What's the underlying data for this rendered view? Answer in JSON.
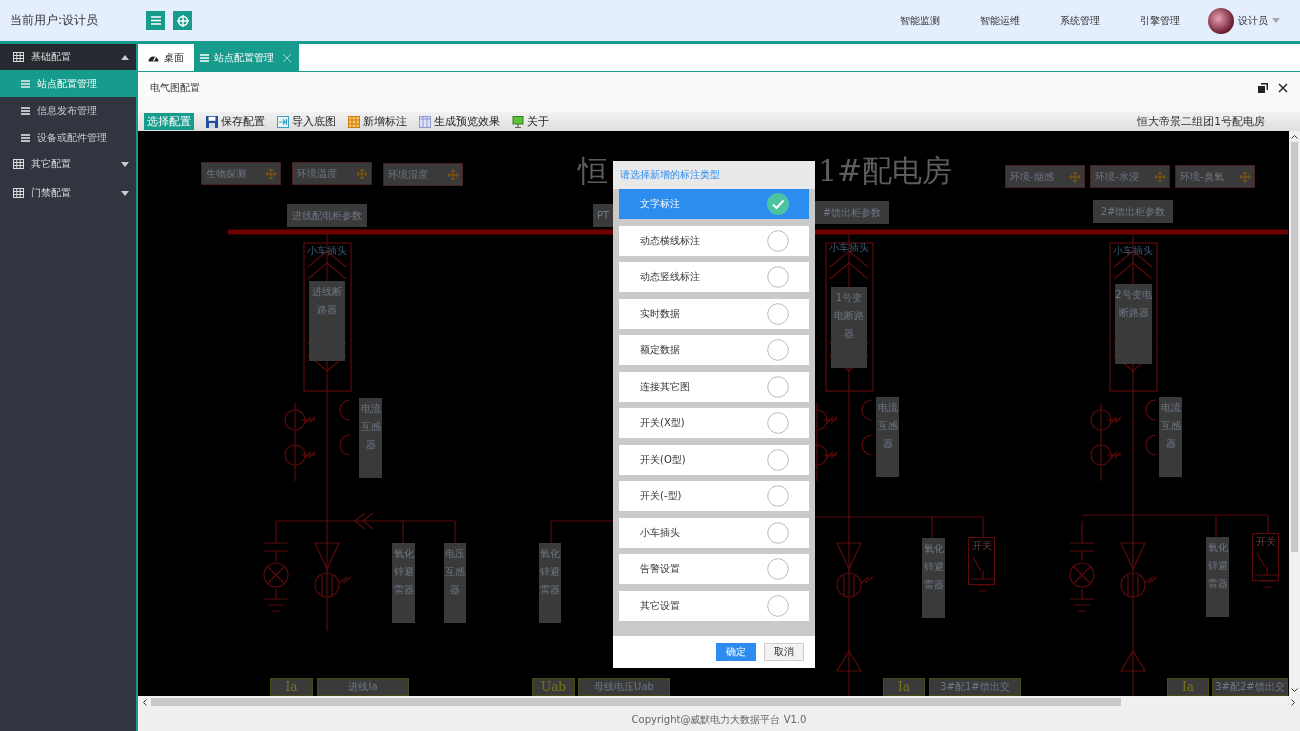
{
  "header": {
    "current_user": "当前用户:设计员",
    "nav": [
      "智能监测",
      "智能运维",
      "系统管理",
      "引擎管理"
    ],
    "user_name": "设计员"
  },
  "sidebar": {
    "groups": [
      {
        "label": "基础配置",
        "expanded": true,
        "children": [
          {
            "label": "站点配置管理",
            "selected": true
          },
          {
            "label": "信息发布管理",
            "selected": false
          },
          {
            "label": "设备或配件管理",
            "selected": false
          }
        ]
      },
      {
        "label": "其它配置",
        "expanded": false
      },
      {
        "label": "门禁配置",
        "expanded": false
      }
    ]
  },
  "tabs": [
    {
      "label": "桌面",
      "selected": false,
      "kind": "home"
    },
    {
      "label": "站点配置管理",
      "selected": true,
      "kind": "page"
    }
  ],
  "panel": {
    "title": "电气图配置"
  },
  "toolbar": {
    "buttons": [
      {
        "label": "选择配置",
        "kind": "primary"
      },
      {
        "label": "保存配置",
        "kind": "save"
      },
      {
        "label": "导入底图",
        "kind": "import"
      },
      {
        "label": "新增标注",
        "kind": "annotate"
      },
      {
        "label": "生成预览效果",
        "kind": "preview"
      },
      {
        "label": "关于",
        "kind": "about"
      }
    ],
    "site_name": "恒大帝景二组团1号配电房"
  },
  "diagram": {
    "title_parts": [
      "恒",
      "1#配电房"
    ],
    "sensors": [
      "生物探测",
      "环境温度",
      "环境湿度",
      "环境-烟感",
      "环境-水浸",
      "环境-臭氧"
    ],
    "parameter_boxes": [
      "进线配电柜参数",
      "PT",
      "#馈出柜参数",
      "2#馈出柜参数"
    ],
    "devices": [
      {
        "kind": "cart",
        "label": "小车插头"
      },
      {
        "kind": "cart",
        "label": "小车插头"
      },
      {
        "kind": "cart",
        "label": "小车插头"
      },
      {
        "kind": "device",
        "label": "进线断路器"
      },
      {
        "kind": "device",
        "label": "1号变电断路器"
      },
      {
        "kind": "device",
        "label": "2号变电断路器"
      },
      {
        "kind": "device",
        "label": "电流互感器"
      },
      {
        "kind": "device",
        "label": "电流互感器"
      },
      {
        "kind": "device",
        "label": "电流互感器"
      },
      {
        "kind": "device",
        "label": "氧化锌避雷器"
      },
      {
        "kind": "device",
        "label": "电压互感器"
      },
      {
        "kind": "device",
        "label": "氧化锌避雷器"
      },
      {
        "kind": "device",
        "label": "氧化锌避雷器"
      },
      {
        "kind": "switch",
        "label": "开关"
      },
      {
        "kind": "device",
        "label": "氧化锌避雷器"
      },
      {
        "kind": "switch",
        "label": "开关"
      }
    ],
    "readings": [
      {
        "kind": "symbol",
        "label": "Ia"
      },
      {
        "kind": "name",
        "label": "进线Ia"
      },
      {
        "kind": "symbol",
        "label": "Uab"
      },
      {
        "kind": "name",
        "label": "母线电压Uab"
      },
      {
        "kind": "symbol",
        "label": "Ia"
      },
      {
        "kind": "name",
        "label": "3#配1#馈出交"
      },
      {
        "kind": "symbol",
        "label": "Ia"
      },
      {
        "kind": "name",
        "label": "3#配2#馈出交"
      }
    ]
  },
  "dialog": {
    "title": "请选择新增的标注类型",
    "options": [
      {
        "label": "文字标注",
        "selected": true
      },
      {
        "label": "动态横线标注",
        "selected": false
      },
      {
        "label": "动态竖线标注",
        "selected": false
      },
      {
        "label": "实时数据",
        "selected": false
      },
      {
        "label": "额定数据",
        "selected": false
      },
      {
        "label": "连接其它图",
        "selected": false
      },
      {
        "label": "开关(X型)",
        "selected": false
      },
      {
        "label": "开关(O型)",
        "selected": false
      },
      {
        "label": "开关(-型)",
        "selected": false
      },
      {
        "label": "小车插头",
        "selected": false
      },
      {
        "label": "告警设置",
        "selected": false
      },
      {
        "label": "其它设置",
        "selected": false
      }
    ],
    "buttons": [
      {
        "label": "确定",
        "kind": "primary"
      },
      {
        "label": "取消",
        "kind": "default"
      }
    ]
  },
  "footer": "Copyright@威默电力大数据平台 V1.0"
}
